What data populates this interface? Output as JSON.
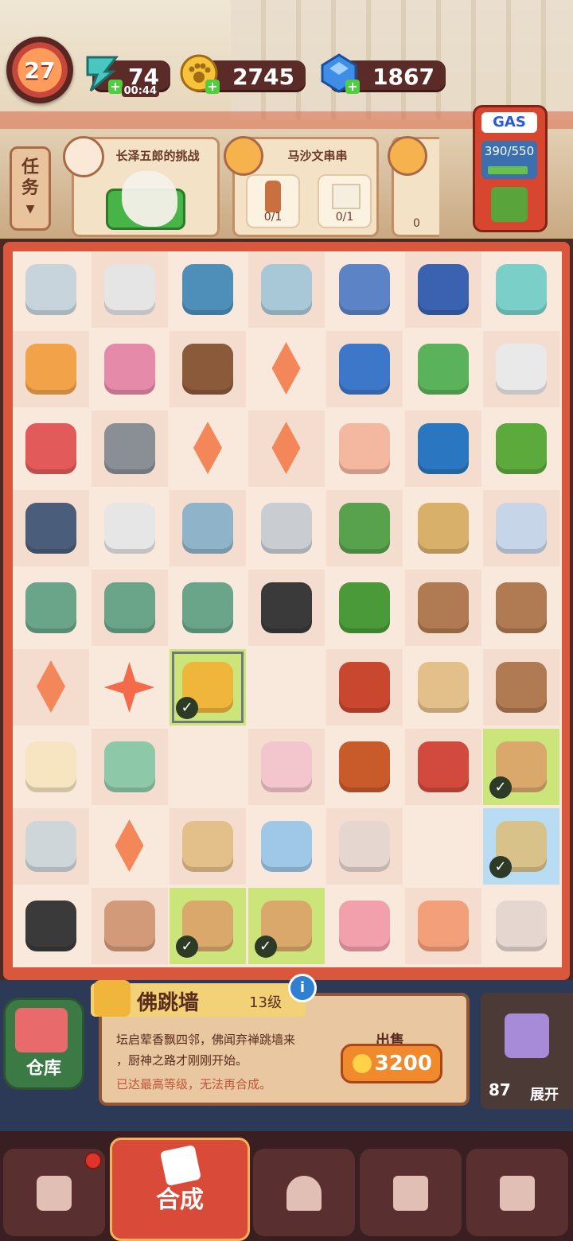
{
  "top": {
    "level": "27",
    "energy": "74",
    "energy_timer": "00:44",
    "coins": "2745",
    "gems": "1867"
  },
  "quests": {
    "tab_label_1": "任",
    "tab_label_2": "务",
    "card1_title": "长泽五郎的挑战",
    "card2_title": "马沙文串串",
    "card2_slot1_count": "0/1",
    "card2_slot2_count": "0/1",
    "card3_slot1_count": "0"
  },
  "gas": {
    "label": "GAS",
    "reading": "390/550",
    "fill": 0.71
  },
  "board": {
    "rows": 9,
    "cols": 7,
    "items": [
      [
        "stopwatch",
        "printer",
        "bento-box",
        "jigsaw-picture",
        "notepad",
        "drum",
        "jar-lid"
      ],
      [
        "skewer-card",
        "hairbrush",
        "braised-pot",
        "orange-gem",
        "house",
        "calendar-3",
        "toaster"
      ],
      [
        "music-box",
        "safe",
        "orange-gem",
        "orange-gem",
        "folded-paper",
        "cooler-box",
        "herb-board"
      ],
      [
        "chef-apron",
        "chef-coat",
        "cabinet",
        "fridge",
        "delivery-scooter",
        "hand-truck",
        "spiral-notepad"
      ],
      [
        "rice-cooker",
        "rice-cooker",
        "rice-cooker",
        "dynamite",
        "bonsai",
        "spice-rack",
        "spice-rack"
      ],
      [
        "orange-gem",
        "orange-star",
        "buddha-jump-wall",
        "",
        "chili-jar",
        "rice-board",
        "spice-rack"
      ],
      [
        "egg",
        "ruler",
        "",
        "towel",
        "soy-bottle",
        "pickle-jar",
        "takeout-bag"
      ],
      [
        "bowl",
        "orange-gem",
        "rice-board",
        "bubble-pot",
        "sugar-jar",
        "",
        "beans-board"
      ],
      [
        "sauce-bottle",
        "meatball",
        "takeout-bag",
        "takeout-bag",
        "cup",
        "shrimp-ball",
        "sugar-jar"
      ]
    ]
  },
  "info": {
    "storage_label": "仓库",
    "item_name": "佛跳墙",
    "item_level": "13级",
    "desc_line1": "坛启荤香飘四邻，佛闻弃禅跳墙来",
    "desc_line2": "，厨神之路才刚刚开始。",
    "desc_note": "已达最高等级，无法再合成。",
    "sell_label": "出售",
    "sell_price": "3200",
    "chest_count": "87",
    "chest_label": "展开"
  },
  "nav": {
    "merge_label": "合成"
  },
  "colors": {
    "board_border": "#d9573d",
    "check_green": "#cbe57a",
    "check_blue": "#b8dcf2",
    "accent": "#f08a2c"
  }
}
